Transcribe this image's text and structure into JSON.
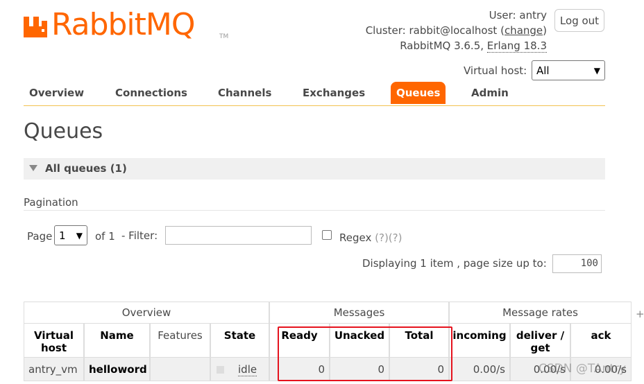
{
  "brand": {
    "name": "RabbitMQ",
    "tm": "TM",
    "color": "#ff6600"
  },
  "header": {
    "user_prefix": "User:",
    "user": "antry",
    "cluster_prefix": "Cluster:",
    "cluster": "rabbit@localhost",
    "change_link": "change",
    "version": "RabbitMQ 3.6.5,",
    "erlang": "Erlang 18.3",
    "logout": "Log out",
    "vhost_label": "Virtual host:",
    "vhost_value": "All"
  },
  "tabs": [
    {
      "label": "Overview"
    },
    {
      "label": "Connections"
    },
    {
      "label": "Channels"
    },
    {
      "label": "Exchanges"
    },
    {
      "label": "Queues",
      "active": true
    },
    {
      "label": "Admin"
    }
  ],
  "page_title": "Queues",
  "section": {
    "label": "All queues (1)"
  },
  "pagination": {
    "label": "Pagination",
    "page_label": "Page",
    "page_value": "1",
    "of_label": "of 1",
    "filter_label": "- Filter:",
    "filter_value": "",
    "regex_label": "Regex",
    "regex_help": "(?)(?)",
    "displaying": "Displaying 1 item , page size up to:",
    "page_size": "100"
  },
  "table": {
    "groups": [
      "Overview",
      "Messages",
      "Message rates"
    ],
    "columns": {
      "vhost": "Virtual host",
      "name": "Name",
      "features": "Features",
      "state": "State",
      "ready": "Ready",
      "unacked": "Unacked",
      "total": "Total",
      "incoming": "incoming",
      "deliver_get": "deliver / get",
      "ack": "ack"
    },
    "rows": [
      {
        "vhost": "antry_vm",
        "name": "helloword",
        "features": "",
        "state": "idle",
        "ready": "0",
        "unacked": "0",
        "total": "0",
        "incoming": "0.00/s",
        "deliver_get": "0.00/s",
        "ack": "0.00/s"
      }
    ],
    "add_column": "+"
  },
  "watermark": "CSDN @TAntry",
  "highlight_color": "#e5121d"
}
